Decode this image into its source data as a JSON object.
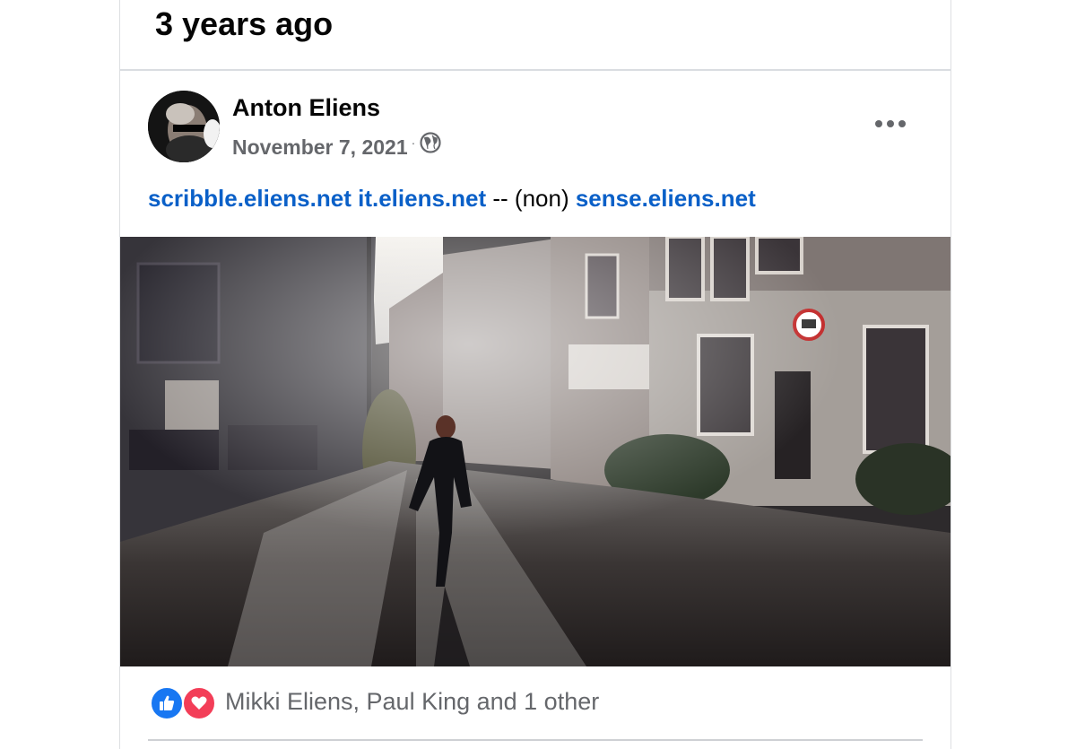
{
  "memory": {
    "header": "3 years ago"
  },
  "post": {
    "author": "Anton Eliens",
    "date": "November 7, 2021",
    "meta_separator": "·",
    "privacy_icon": "globe-icon",
    "more_icon": "more-dots-icon",
    "text": {
      "link1": "scribble.eliens.net",
      "link2": "it.eliens.net",
      "separator": " -- (non) ",
      "link3": "sense.eliens.net"
    }
  },
  "reactions": {
    "icons": [
      "like-icon",
      "love-icon"
    ],
    "summary": "Mikki Eliens, Paul King and 1 other"
  },
  "colors": {
    "link": "#0a60c8",
    "like": "#1877f2",
    "love": "#f33e58",
    "secondary_text": "#65676b"
  }
}
